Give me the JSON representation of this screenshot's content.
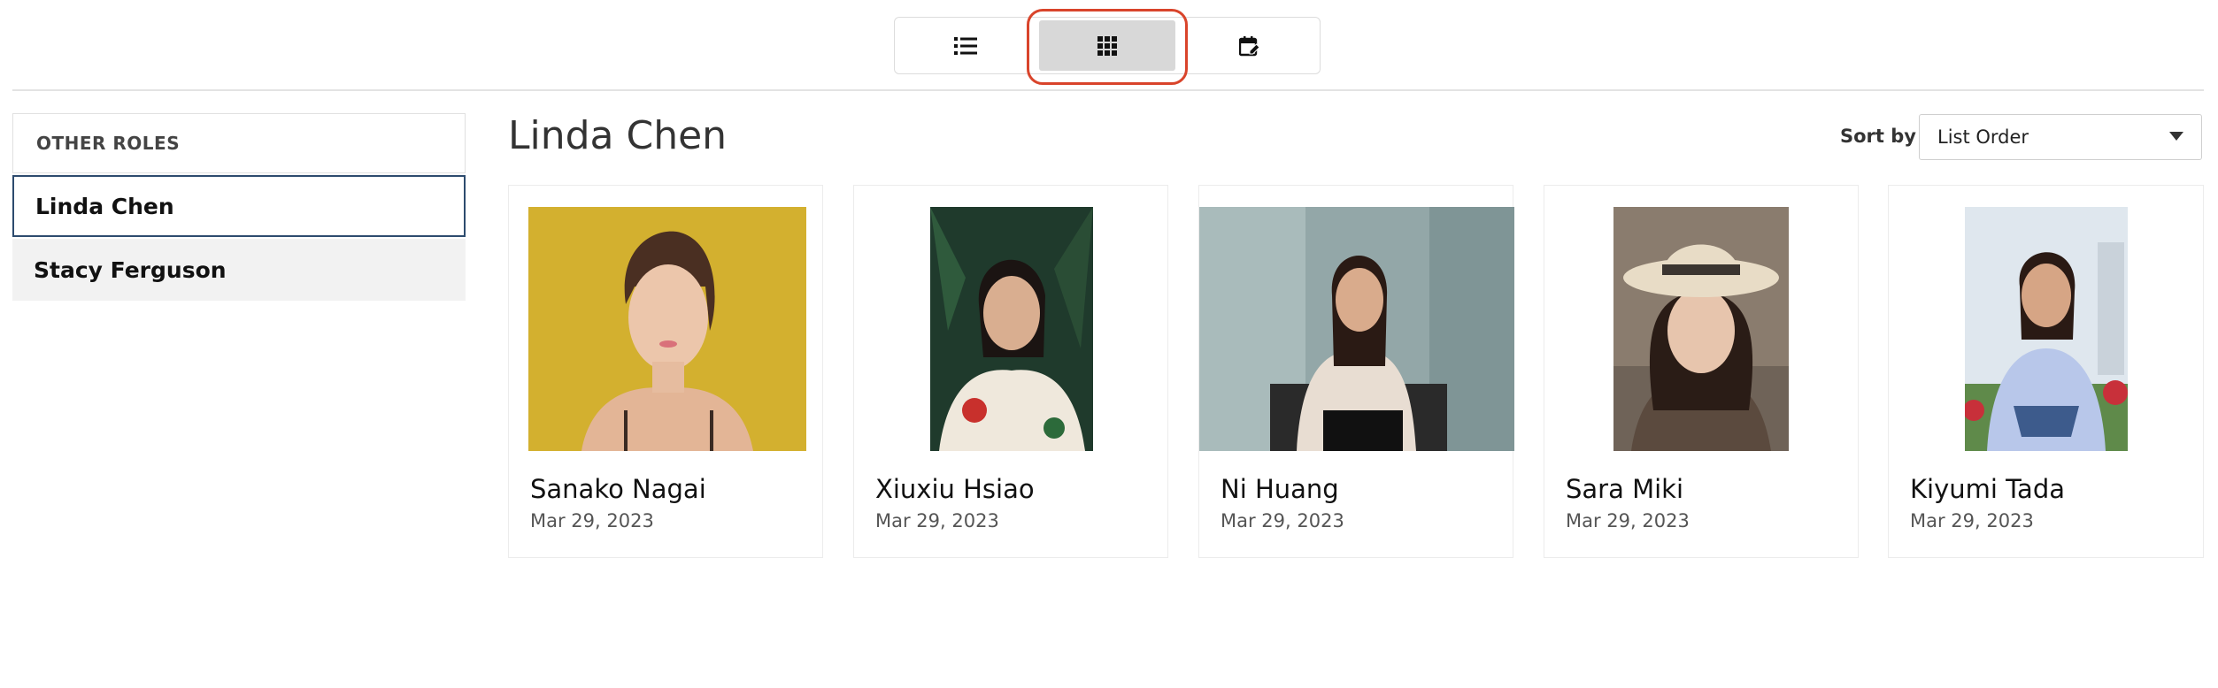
{
  "view_toggle": {
    "items": [
      {
        "icon": "list-icon",
        "active": false
      },
      {
        "icon": "grid-icon",
        "active": true
      },
      {
        "icon": "calendar-edit-icon",
        "active": false
      }
    ],
    "highlight_color": "#d9442b"
  },
  "sidebar": {
    "header": "OTHER ROLES",
    "items": [
      {
        "label": "Linda Chen",
        "selected": true
      },
      {
        "label": "Stacy Ferguson",
        "selected": false
      }
    ]
  },
  "main": {
    "title": "Linda Chen",
    "sort": {
      "label": "Sort by",
      "value": "List Order"
    },
    "cards": [
      {
        "name": "Sanako Nagai",
        "date": "Mar 29, 2023"
      },
      {
        "name": "Xiuxiu Hsiao",
        "date": "Mar 29, 2023"
      },
      {
        "name": "Ni Huang",
        "date": "Mar 29, 2023"
      },
      {
        "name": "Sara Miki",
        "date": "Mar 29, 2023"
      },
      {
        "name": "Kiyumi Tada",
        "date": "Mar 29, 2023"
      }
    ]
  },
  "colors": {
    "selected_border": "#2d4b6e",
    "active_toggle": "#d8d8d8"
  }
}
